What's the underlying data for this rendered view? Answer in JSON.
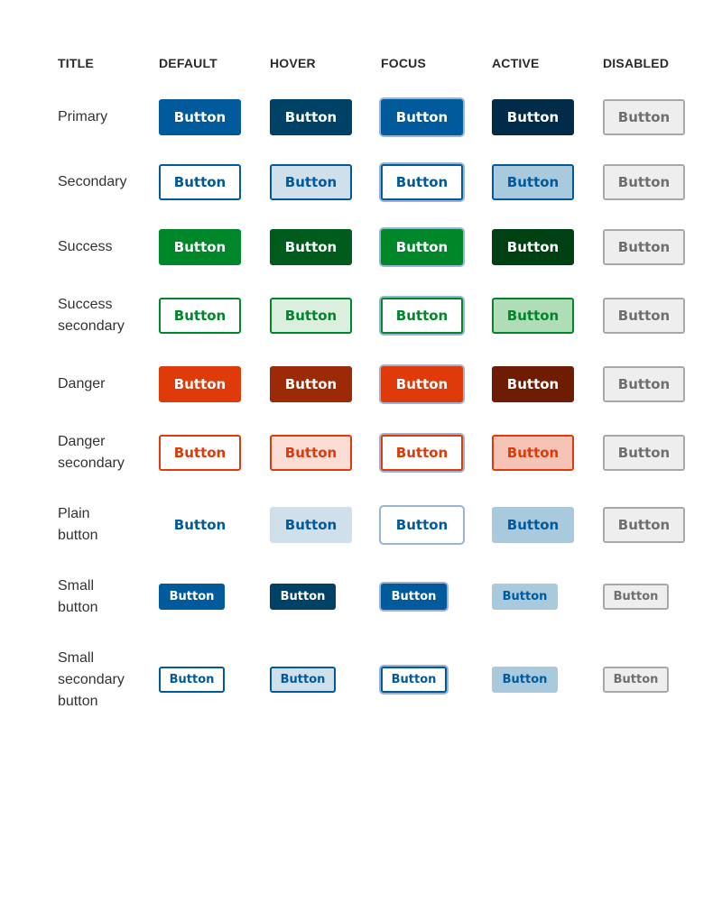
{
  "header": [
    "TITLE",
    "DEFAULT",
    "HOVER",
    "FOCUS",
    "ACTIVE",
    "DISABLED"
  ],
  "button_label": "Button",
  "rows": [
    {
      "title": [
        "Primary"
      ],
      "size": "normal",
      "states": [
        {
          "bg": "#005a9c",
          "border": "#005a9c",
          "color": "#ffffff"
        },
        {
          "bg": "#004166",
          "border": "#004166",
          "color": "#ffffff"
        },
        {
          "bg": "#005a9c",
          "border": "#005a9c",
          "color": "#ffffff",
          "focus": true
        },
        {
          "bg": "#002b49",
          "border": "#002b49",
          "color": "#ffffff"
        },
        {
          "disabled": true
        }
      ]
    },
    {
      "title": [
        "Secondary"
      ],
      "size": "normal",
      "states": [
        {
          "bg": "#ffffff",
          "border": "#005a9c",
          "color": "#005a9c"
        },
        {
          "bg": "#cfe0ea",
          "border": "#005a9c",
          "color": "#005a9c"
        },
        {
          "bg": "#ffffff",
          "border": "#005a9c",
          "color": "#005a9c",
          "focus": true
        },
        {
          "bg": "#a8cadc",
          "border": "#005a9c",
          "color": "#005a9c"
        },
        {
          "disabled": true
        }
      ]
    },
    {
      "title": [
        "Success"
      ],
      "size": "normal",
      "states": [
        {
          "bg": "#00872a",
          "border": "#00872a",
          "color": "#ffffff"
        },
        {
          "bg": "#005c1d",
          "border": "#005c1d",
          "color": "#ffffff"
        },
        {
          "bg": "#00872a",
          "border": "#00872a",
          "color": "#ffffff",
          "focus": true
        },
        {
          "bg": "#004114",
          "border": "#004114",
          "color": "#ffffff"
        },
        {
          "disabled": true
        }
      ]
    },
    {
      "title": [
        "Success",
        "secondary"
      ],
      "size": "normal",
      "states": [
        {
          "bg": "#ffffff",
          "border": "#00872a",
          "color": "#00872a"
        },
        {
          "bg": "#dcefdf",
          "border": "#00872a",
          "color": "#00872a"
        },
        {
          "bg": "#ffffff",
          "border": "#00872a",
          "color": "#00872a",
          "focus": true
        },
        {
          "bg": "#b1dcb8",
          "border": "#00872a",
          "color": "#00872a"
        },
        {
          "disabled": true
        }
      ]
    },
    {
      "title": [
        "Danger"
      ],
      "size": "normal",
      "states": [
        {
          "bg": "#de3a0a",
          "border": "#de3a0a",
          "color": "#ffffff"
        },
        {
          "bg": "#9c2a06",
          "border": "#9c2a06",
          "color": "#ffffff"
        },
        {
          "bg": "#de3a0a",
          "border": "#de3a0a",
          "color": "#ffffff",
          "focus": true
        },
        {
          "bg": "#6e1d04",
          "border": "#6e1d04",
          "color": "#ffffff"
        },
        {
          "disabled": true
        }
      ]
    },
    {
      "title": [
        "Danger",
        "secondary"
      ],
      "size": "normal",
      "states": [
        {
          "bg": "#ffffff",
          "border": "#de3a0a",
          "color": "#de3a0a"
        },
        {
          "bg": "#fbddd6",
          "border": "#de3a0a",
          "color": "#de3a0a"
        },
        {
          "bg": "#ffffff",
          "border": "#de3a0a",
          "color": "#de3a0a",
          "focus": true
        },
        {
          "bg": "#f5c4b6",
          "border": "#de3a0a",
          "color": "#de3a0a"
        },
        {
          "disabled": true
        }
      ]
    },
    {
      "title": [
        "Plain",
        "button"
      ],
      "size": "normal",
      "states": [
        {
          "bg": "transparent",
          "border": "transparent",
          "color": "#005a9c"
        },
        {
          "bg": "#cfe0ea",
          "border": "#cfe0ea",
          "color": "#005a9c"
        },
        {
          "bg": "#ffffff",
          "border": "#ffffff",
          "color": "#005a9c",
          "focus": true
        },
        {
          "bg": "#a8cadc",
          "border": "#a8cadc",
          "color": "#005a9c"
        },
        {
          "disabled": true
        }
      ]
    },
    {
      "title": [
        "Small",
        "button"
      ],
      "size": "small",
      "states": [
        {
          "bg": "#005a9c",
          "border": "#005a9c",
          "color": "#ffffff"
        },
        {
          "bg": "#004166",
          "border": "#004166",
          "color": "#ffffff"
        },
        {
          "bg": "#005a9c",
          "border": "#005a9c",
          "color": "#ffffff",
          "focus": true
        },
        {
          "bg": "#a8cadc",
          "border": "#a8cadc",
          "color": "#005a9c"
        },
        {
          "disabled": true
        }
      ]
    },
    {
      "title": [
        "Small",
        "secondary",
        "button"
      ],
      "size": "small",
      "states": [
        {
          "bg": "#ffffff",
          "border": "#005a9c",
          "color": "#005a9c"
        },
        {
          "bg": "#cfe0ea",
          "border": "#005a9c",
          "color": "#005a9c"
        },
        {
          "bg": "#ffffff",
          "border": "#005a9c",
          "color": "#005a9c",
          "focus": true
        },
        {
          "bg": "#a8cadc",
          "border": "#a8cadc",
          "color": "#005a9c"
        },
        {
          "disabled": true
        }
      ]
    }
  ]
}
